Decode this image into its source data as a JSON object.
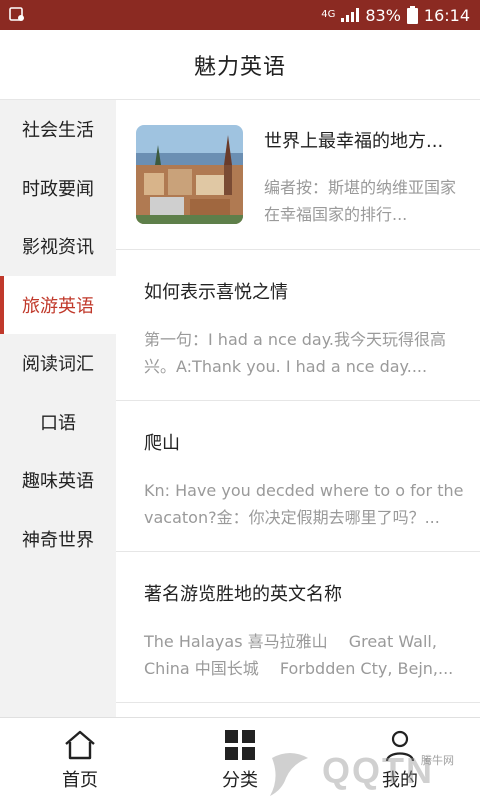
{
  "status_bar": {
    "network": "4G",
    "battery": "83%",
    "time": "16:14"
  },
  "header": {
    "title": "魅力英语"
  },
  "sidebar": {
    "items": [
      {
        "label": "社会生活",
        "active": false
      },
      {
        "label": "时政要闻",
        "active": false
      },
      {
        "label": "影视资讯",
        "active": false
      },
      {
        "label": "旅游英语",
        "active": true
      },
      {
        "label": "阅读词汇",
        "active": false
      },
      {
        "label": "口语",
        "active": false
      },
      {
        "label": "趣味英语",
        "active": false
      },
      {
        "label": "神奇世界",
        "active": false
      }
    ]
  },
  "articles": [
    {
      "title": "世界上最幸福的地方...",
      "desc": "编者按：斯堪的纳维亚国家在幸福国家的排行...",
      "has_image": true
    },
    {
      "title": "如何表示喜悦之情",
      "desc": "第一句：I had a nce day.我今天玩得很高兴。A:Thank you. I had a nce day...."
    },
    {
      "title": "爬山",
      "desc": "Kn: Have you decded where to o for the vacaton?金：你决定假期去哪里了吗？..."
    },
    {
      "title": "著名游览胜地的英文名称",
      "desc": "The Halayas 喜马拉雅山　 Great Wall, China 中国长城　 Forbdden Cty, Bejn,..."
    }
  ],
  "bottom_nav": {
    "home": "首页",
    "category": "分类",
    "me": "我的"
  },
  "watermark": {
    "brand": "QQTN",
    "small": "腾牛网"
  },
  "colors": {
    "status_bar": "#8b2a22",
    "accent": "#c0392b",
    "sidebar_bg": "#f2f2f2",
    "muted_text": "#9a9a9a"
  }
}
